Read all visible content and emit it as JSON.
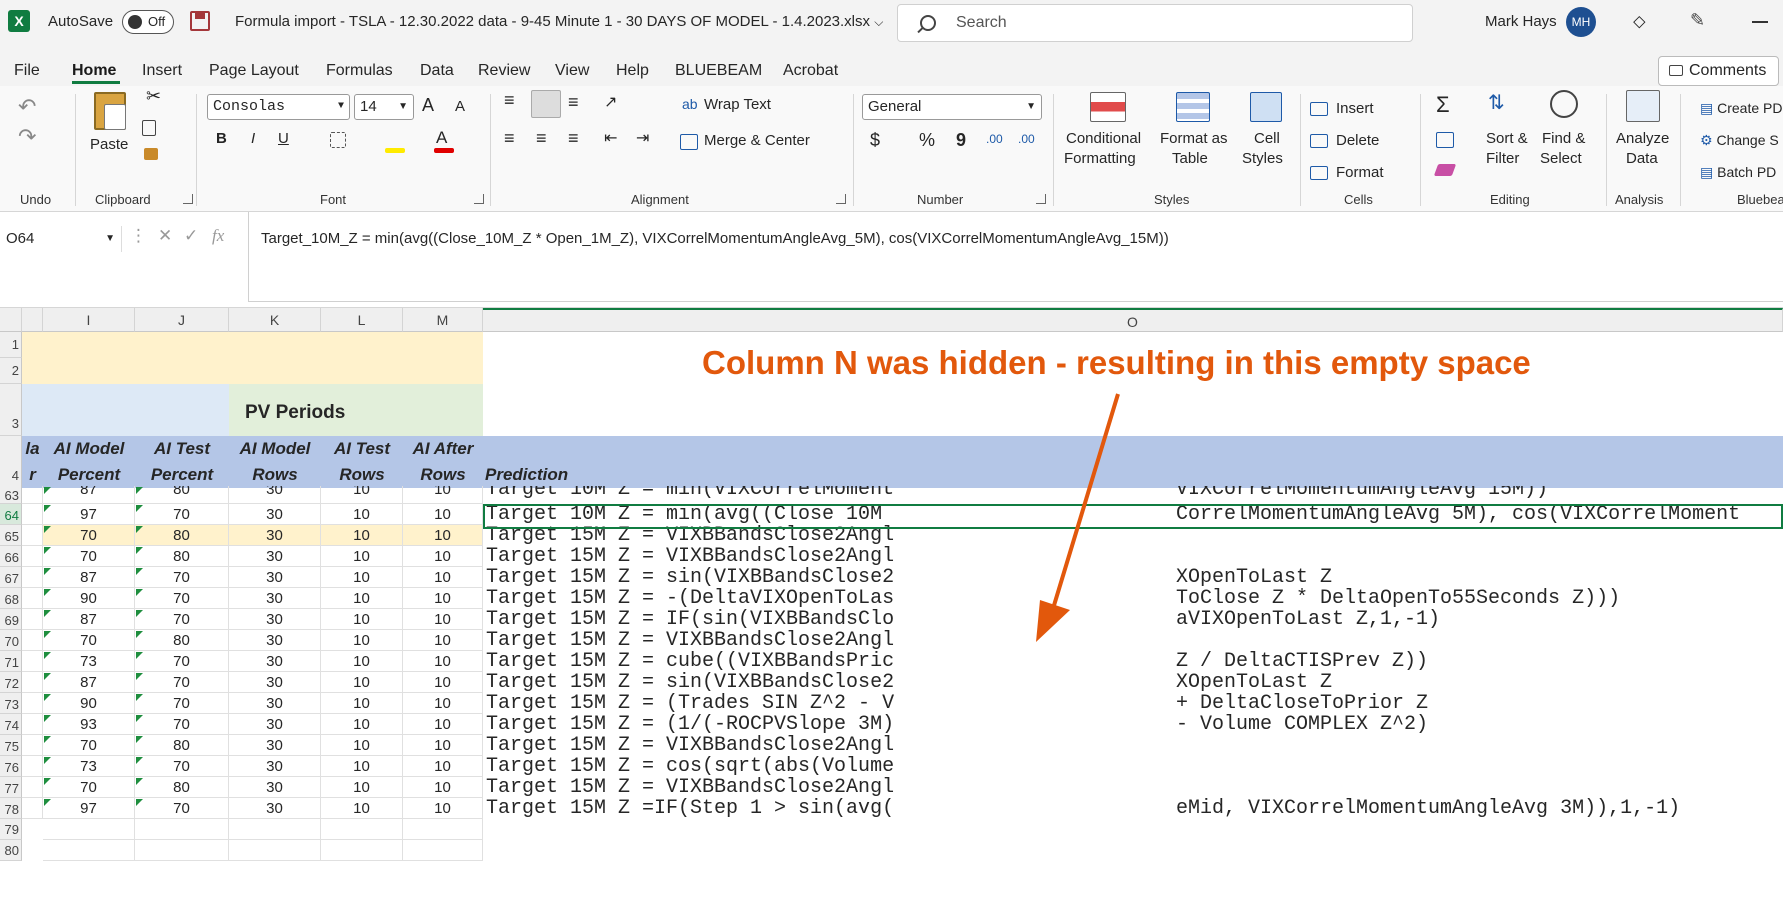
{
  "titlebar": {
    "app_icon": "X",
    "autosave_label": "AutoSave",
    "autosave_state": "Off",
    "document_title": "Formula import - TSLA - 12.30.2022 data - 9-45 Minute 1 - 30 DAYS OF MODEL - 1.4.2023.xlsx",
    "title_chevron": "⌵",
    "search_placeholder": "Search",
    "user_name": "Mark Hays",
    "user_initials": "MH",
    "diamond_icon": "⬦",
    "pen_icon": "✎"
  },
  "menu": {
    "tabs": [
      "File",
      "Home",
      "Insert",
      "Page Layout",
      "Formulas",
      "Data",
      "Review",
      "View",
      "Help",
      "BLUEBEAM",
      "Acrobat"
    ],
    "comments": "Comments"
  },
  "ribbon": {
    "undo": {
      "label": "Undo",
      "undo_glyph": "↶",
      "redo_glyph": "↷"
    },
    "clipboard": {
      "label": "Clipboard",
      "paste": "Paste"
    },
    "font": {
      "label": "Font",
      "family": "Consolas",
      "size": "14",
      "bold": "B",
      "italic": "I",
      "underline": "U",
      "grow": "A",
      "shrink": "A",
      "color_letter": "A"
    },
    "alignment": {
      "label": "Alignment",
      "wrap": "Wrap Text",
      "merge": "Merge & Center"
    },
    "number": {
      "label": "Number",
      "format": "General",
      "currency": "$",
      "percent": "%",
      "comma": "9",
      "inc_decimals": ".00",
      "dec_decimals": ".00"
    },
    "styles": {
      "label": "Styles",
      "conditional": [
        "Conditional",
        "Formatting"
      ],
      "format_table": [
        "Format as",
        "Table"
      ],
      "cell_styles": [
        "Cell",
        "Styles"
      ]
    },
    "cells": {
      "label": "Cells",
      "insert": "Insert",
      "delete": "Delete",
      "format": "Format"
    },
    "editing": {
      "label": "Editing",
      "sum_glyph": "Σ",
      "sort": [
        "Sort &",
        "Filter"
      ],
      "find": [
        "Find &",
        "Select"
      ]
    },
    "analysis": {
      "label": "Analysis",
      "analyze": [
        "Analyze",
        "Data"
      ]
    },
    "bluebeam": {
      "label": "Bluebea",
      "create": "Create PD",
      "change": "Change S",
      "batch": "Batch PD"
    }
  },
  "formula_bar": {
    "name_box": "O64",
    "fx": "fx",
    "formula": "Target_10M_Z = min(avg((Close_10M_Z * Open_1M_Z), VIXCorrelMomentumAngleAvg_5M), cos(VIXCorrelMomentumAngleAvg_15M))"
  },
  "grid": {
    "columns": [
      "I",
      "J",
      "K",
      "L",
      "M",
      "O"
    ],
    "header_rows": [
      "1",
      "2",
      "3",
      "4"
    ],
    "pv_periods": "PV Periods",
    "left_partial": [
      "la",
      "r"
    ],
    "col_headers": [
      [
        "AI Model",
        "Percent"
      ],
      [
        "AI Test",
        "Percent"
      ],
      [
        "AI Model",
        "Rows"
      ],
      [
        "AI Test",
        "Rows"
      ],
      [
        "AI After",
        "Rows"
      ]
    ],
    "prediction_header": "Prediction",
    "rows": [
      {
        "num": "63",
        "v": [
          "87",
          "80",
          "30",
          "10",
          "10"
        ],
        "pred": "Target 10M Z = min(VIXCorrelMoment",
        "tail": "VIXCorrelMomentumAngleAvg 15M))"
      },
      {
        "num": "64",
        "v": [
          "97",
          "70",
          "30",
          "10",
          "10"
        ],
        "pred": "Target 10M Z = min(avg((Close 10M",
        "tail": "CorrelMomentumAngleAvg 5M), cos(VIXCorrelMoment"
      },
      {
        "num": "65",
        "v": [
          "70",
          "80",
          "30",
          "10",
          "10"
        ],
        "pred": "Target 15M Z = VIXBBandsClose2Angl",
        "tail": ""
      },
      {
        "num": "66",
        "v": [
          "70",
          "80",
          "30",
          "10",
          "10"
        ],
        "pred": "Target 15M Z = VIXBBandsClose2Angl",
        "tail": ""
      },
      {
        "num": "67",
        "v": [
          "87",
          "70",
          "30",
          "10",
          "10"
        ],
        "pred": "Target 15M Z = sin(VIXBBandsClose2",
        "tail": "XOpenToLast Z"
      },
      {
        "num": "68",
        "v": [
          "90",
          "70",
          "30",
          "10",
          "10"
        ],
        "pred": "Target 15M Z = -(DeltaVIXOpenToLas",
        "tail": "ToClose Z * DeltaOpenTo55Seconds Z)))"
      },
      {
        "num": "69",
        "v": [
          "87",
          "70",
          "30",
          "10",
          "10"
        ],
        "pred": "Target 15M Z = IF(sin(VIXBBandsClo",
        "tail": "aVIXOpenToLast Z,1,-1)"
      },
      {
        "num": "70",
        "v": [
          "70",
          "80",
          "30",
          "10",
          "10"
        ],
        "pred": "Target 15M Z = VIXBBandsClose2Angl",
        "tail": ""
      },
      {
        "num": "71",
        "v": [
          "73",
          "70",
          "30",
          "10",
          "10"
        ],
        "pred": "Target 15M Z = cube((VIXBBandsPric",
        "tail": "Z / DeltaCTISPrev Z))"
      },
      {
        "num": "72",
        "v": [
          "87",
          "70",
          "30",
          "10",
          "10"
        ],
        "pred": "Target 15M Z = sin(VIXBBandsClose2",
        "tail": "XOpenToLast Z"
      },
      {
        "num": "73",
        "v": [
          "90",
          "70",
          "30",
          "10",
          "10"
        ],
        "pred": "Target 15M Z = (Trades SIN Z^2 - V",
        "tail": "+ DeltaCloseToPrior Z"
      },
      {
        "num": "74",
        "v": [
          "93",
          "70",
          "30",
          "10",
          "10"
        ],
        "pred": "Target 15M Z = (1/(-ROCPVSlope 3M)",
        "tail": " - Volume COMPLEX Z^2)"
      },
      {
        "num": "75",
        "v": [
          "70",
          "80",
          "30",
          "10",
          "10"
        ],
        "pred": "Target 15M Z = VIXBBandsClose2Angl",
        "tail": ""
      },
      {
        "num": "76",
        "v": [
          "73",
          "70",
          "30",
          "10",
          "10"
        ],
        "pred": "Target 15M Z = cos(sqrt(abs(Volume",
        "tail": ""
      },
      {
        "num": "77",
        "v": [
          "70",
          "80",
          "30",
          "10",
          "10"
        ],
        "pred": "Target 15M Z = VIXBBandsClose2Angl",
        "tail": ""
      },
      {
        "num": "78",
        "v": [
          "97",
          "70",
          "30",
          "10",
          "10"
        ],
        "pred": "Target 15M Z =IF(Step 1 > sin(avg(",
        "tail": "eMid, VIXCorrelMomentumAngleAvg 3M)),1,-1)"
      }
    ],
    "empty_rows": [
      "79",
      "80"
    ]
  },
  "annotation": {
    "text": "Column N was hidden - resulting in this empty space",
    "color": "#e2580c"
  },
  "colors": {
    "excel_green": "#107c41",
    "header_blue": "#b4c6e7",
    "light_blue": "#dde9f6",
    "light_green": "#e2efda",
    "light_yellow": "#fff2cc"
  }
}
